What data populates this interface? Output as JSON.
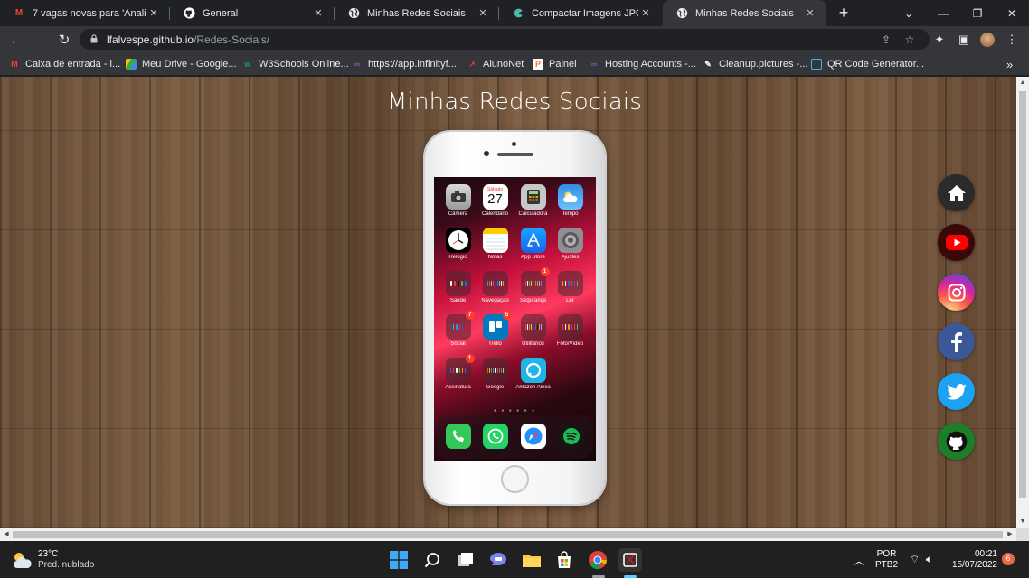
{
  "browser": {
    "tabs": [
      {
        "title": "7 vagas novas para 'Analista",
        "icon": "gmail-icon"
      },
      {
        "title": "General",
        "icon": "github-icon"
      },
      {
        "title": "Minhas Redes Sociais",
        "icon": "globe-icon"
      },
      {
        "title": "Compactar Imagens JPG Onl",
        "icon": "compress-icon"
      },
      {
        "title": "Minhas Redes Sociais",
        "icon": "globe-icon",
        "active": true
      }
    ],
    "url": {
      "host": "lfalvespe.github.io",
      "path": "/Redes-Sociais/"
    },
    "bookmarks": [
      {
        "label": "Caixa de entrada - l...",
        "icon": "gmail-icon",
        "color": "#ea4335"
      },
      {
        "label": "Meu Drive - Google...",
        "icon": "drive-icon",
        "color": "#34a853"
      },
      {
        "label": "W3Schools Online...",
        "icon": "w3schools-icon",
        "color": "#04aa6d"
      },
      {
        "label": "https://app.infinityf...",
        "icon": "infinity-icon",
        "color": "#7e57c2"
      },
      {
        "label": "AlunoNet",
        "icon": "alunonet-icon",
        "color": "#e53935"
      },
      {
        "label": "Painel",
        "icon": "painel-icon",
        "color": "#ff7043"
      },
      {
        "label": "Hosting Accounts -...",
        "icon": "hosting-icon",
        "color": "#7e57c2"
      },
      {
        "label": "Cleanup.pictures -...",
        "icon": "cleanup-icon",
        "color": "#ffffff"
      },
      {
        "label": "QR Code Generator...",
        "icon": "qrcode-icon",
        "color": "#26c6da"
      }
    ]
  },
  "page": {
    "title": "Minhas Redes Sociais"
  },
  "phone": {
    "calendar": {
      "weekday": "Sábado",
      "day": "27"
    },
    "apps": [
      {
        "label": "Câmera",
        "icon": "camera-icon",
        "color": "#3a3a3c",
        "glyph": "◉"
      },
      {
        "label": "Calendário",
        "icon": "calendar-icon",
        "color": "#ffffff",
        "glyph": ""
      },
      {
        "label": "Calculadora",
        "icon": "calculator-icon",
        "color": "#d4d4d4",
        "glyph": "▦"
      },
      {
        "label": "Tempo",
        "icon": "weather-icon",
        "color": "#3aa0f0",
        "glyph": "☁"
      },
      {
        "label": "Relógio",
        "icon": "clock-icon",
        "color": "#000000",
        "glyph": "◷"
      },
      {
        "label": "Notas",
        "icon": "notes-icon",
        "color": "#fff6d6",
        "glyph": "≡"
      },
      {
        "label": "App Store",
        "icon": "appstore-icon",
        "color": "#1c8ef9",
        "glyph": "A"
      },
      {
        "label": "Ajustes",
        "icon": "settings-icon",
        "color": "#8e8e93",
        "glyph": "⚙"
      },
      {
        "label": "Saúde",
        "icon": "health-folder-icon",
        "folder": true,
        "badge": ""
      },
      {
        "label": "Navegação",
        "icon": "navigation-folder-icon",
        "folder": true,
        "badge": ""
      },
      {
        "label": "Segurança",
        "icon": "security-folder-icon",
        "folder": true,
        "badge": "1"
      },
      {
        "label": "Ler",
        "icon": "read-folder-icon",
        "folder": true,
        "badge": ""
      },
      {
        "label": "Social",
        "icon": "social-folder-icon",
        "folder": true,
        "badge": "7"
      },
      {
        "label": "Trello",
        "icon": "trello-icon",
        "color": "#0079bf",
        "glyph": "▥",
        "badge": "5"
      },
      {
        "label": "Utilitários",
        "icon": "utilities-folder-icon",
        "folder": true,
        "badge": ""
      },
      {
        "label": "Foto/Vídeo",
        "icon": "photo-video-folder-icon",
        "folder": true,
        "badge": ""
      },
      {
        "label": "Assinatura",
        "icon": "signature-folder-icon",
        "folder": true,
        "badge": "1"
      },
      {
        "label": "Google",
        "icon": "google-folder-icon",
        "folder": true,
        "badge": ""
      },
      {
        "label": "Amazon Alexa",
        "icon": "alexa-icon",
        "color": "#1fb5e9",
        "glyph": "○"
      }
    ],
    "dock": [
      {
        "icon": "phone-icon",
        "color": "#34c759",
        "glyph": "✆"
      },
      {
        "icon": "whatsapp-icon",
        "color": "#25d366",
        "glyph": "✆"
      },
      {
        "icon": "safari-icon",
        "color": "#ffffff",
        "glyph": "⊕"
      },
      {
        "icon": "spotify-icon",
        "color": "#191414",
        "glyph": "≋"
      }
    ]
  },
  "social_links": [
    {
      "name": "home",
      "icon": "home-icon",
      "bg": "#2b2b2b"
    },
    {
      "name": "youtube",
      "icon": "youtube-icon",
      "bg": "#3a0a0a"
    },
    {
      "name": "instagram",
      "icon": "instagram-icon",
      "bg": "#c13584"
    },
    {
      "name": "facebook",
      "icon": "facebook-icon",
      "bg": "#3b5998"
    },
    {
      "name": "twitter",
      "icon": "twitter-icon",
      "bg": "#1da1f2"
    },
    {
      "name": "github",
      "icon": "github-icon",
      "bg": "#1b7f2a"
    }
  ],
  "taskbar": {
    "weather": {
      "temp": "23°C",
      "desc": "Pred. nublado"
    },
    "language": {
      "line1": "POR",
      "line2": "PTB2"
    },
    "time": "00:21",
    "date": "15/07/2022",
    "notifications": "6"
  }
}
